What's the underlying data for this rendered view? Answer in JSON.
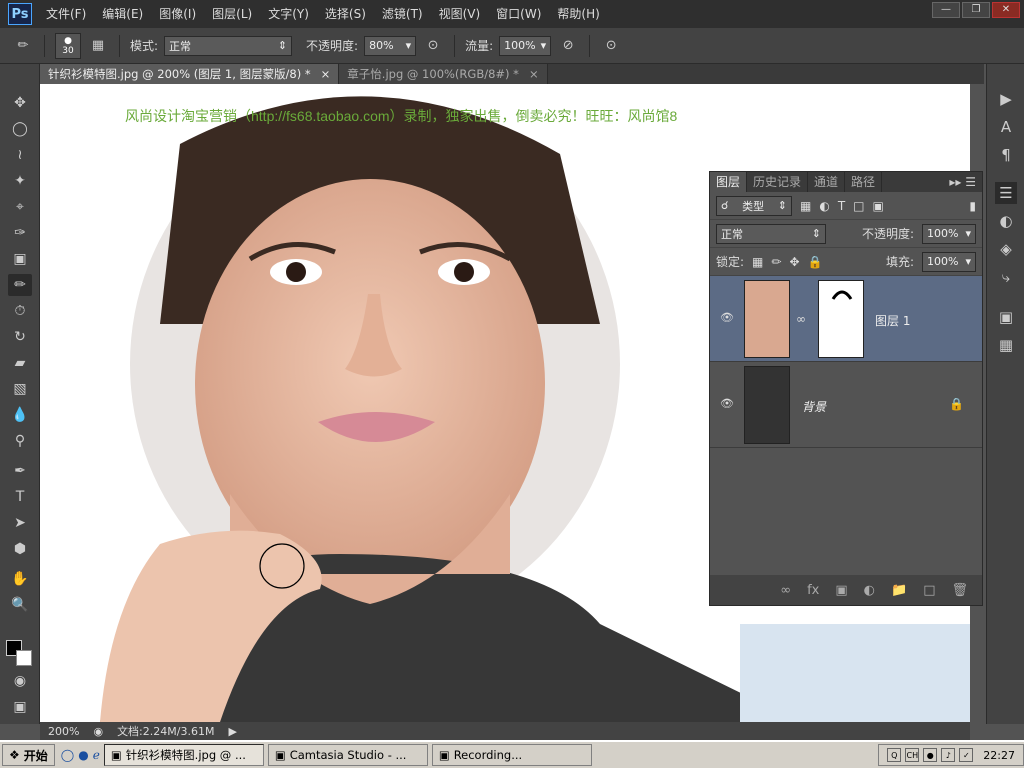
{
  "app": {
    "logo": "Ps"
  },
  "menubar": {
    "items": [
      "文件(F)",
      "编辑(E)",
      "图像(I)",
      "图层(L)",
      "文字(Y)",
      "选择(S)",
      "滤镜(T)",
      "视图(V)",
      "窗口(W)",
      "帮助(H)"
    ]
  },
  "optbar": {
    "brush_size": "30",
    "mode_label": "模式:",
    "mode_value": "正常",
    "opacity_label": "不透明度:",
    "opacity_value": "80%",
    "flow_label": "流量:",
    "flow_value": "100%"
  },
  "tabs": [
    {
      "label": "针织衫模特图.jpg @ 200% (图层 1, 图层蒙版/8) *",
      "close": "×"
    },
    {
      "label": "章子怡.jpg @ 100%(RGB/8#) *",
      "close": "×"
    }
  ],
  "canvas": {
    "watermark": "风尚设计淘宝营销（http://fs68.taobao.com）录制，独家出售，倒卖必究！旺旺：风尚馆8"
  },
  "layers_panel": {
    "tabs": [
      "图层",
      "历史记录",
      "通道",
      "路径"
    ],
    "filter_label": "类型",
    "blend_mode": "正常",
    "opacity_label": "不透明度:",
    "opacity_value": "100%",
    "lock_label": "锁定:",
    "fill_label": "填充:",
    "fill_value": "100%",
    "layers": [
      {
        "name": "图层 1",
        "selected": true
      },
      {
        "name": "背景",
        "selected": false
      }
    ]
  },
  "statusbar": {
    "zoom": "200%",
    "doc": "文档:2.24M/3.61M"
  },
  "taskbar": {
    "start": "开始",
    "items": [
      "针织衫模特图.jpg @ ...",
      "Camtasia Studio - ...",
      "Recording..."
    ],
    "lang": "CH",
    "clock": "22:27"
  },
  "colors": {
    "accent": "#5c6b85",
    "watermark": "#6aaa3a"
  }
}
